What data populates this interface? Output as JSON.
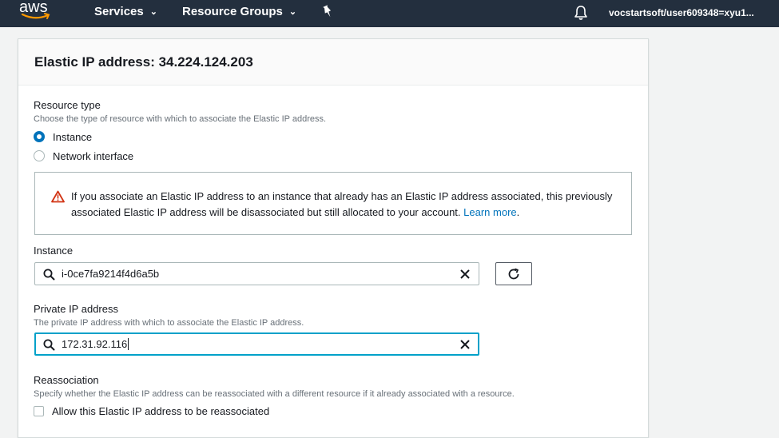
{
  "nav": {
    "logo": "aws",
    "services": "Services",
    "resource_groups": "Resource Groups",
    "user": "vocstartsoft/user609348=xyu1..."
  },
  "panel": {
    "title": "Elastic IP address: 34.224.124.203"
  },
  "resource_type": {
    "label": "Resource type",
    "description": "Choose the type of resource with which to associate the Elastic IP address.",
    "options": [
      {
        "label": "Instance",
        "checked": true
      },
      {
        "label": "Network interface",
        "checked": false
      }
    ]
  },
  "alert": {
    "text": "If you associate an Elastic IP address to an instance that already has an Elastic IP address associated, this previously associated Elastic IP address will be disassociated but still allocated to your account.",
    "link": "Learn more",
    "end": "."
  },
  "instance": {
    "label": "Instance",
    "value": "i-0ce7fa9214f4d6a5b"
  },
  "private_ip": {
    "label": "Private IP address",
    "description": "The private IP address with which to associate the Elastic IP address.",
    "value": "172.31.92.116"
  },
  "reassociation": {
    "label": "Reassociation",
    "description": "Specify whether the Elastic IP address can be reassociated with a different resource if it already associated with a resource.",
    "checkbox_label": "Allow this Elastic IP address to be reassociated",
    "checked": false
  },
  "colors": {
    "nav_bg": "#232f3e",
    "accent": "#0073bb",
    "focus": "#00a1c9",
    "warning": "#d13212"
  },
  "icons": [
    "aws-smile-logo",
    "caret-down-icon",
    "pin-icon",
    "bell-icon",
    "warning-icon",
    "search-icon",
    "clear-icon",
    "refresh-icon"
  ]
}
